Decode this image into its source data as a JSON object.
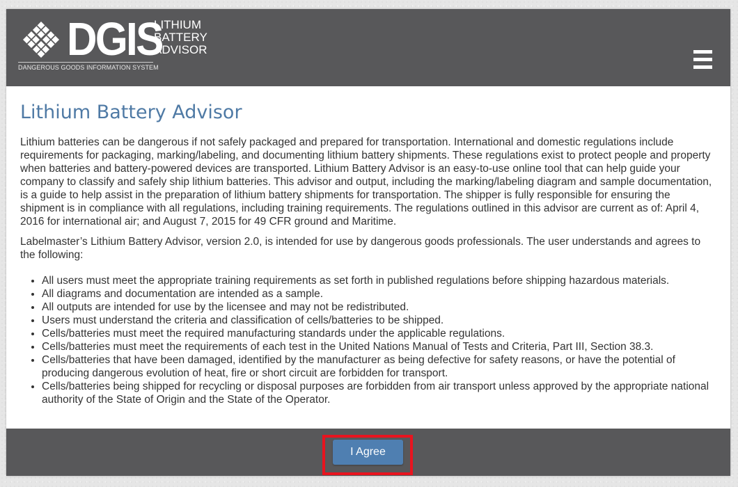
{
  "header": {
    "logo_text": "DGIS",
    "logo_sub_lines": [
      "LITHIUM",
      "BATTERY",
      "ADVISOR"
    ],
    "logo_tagline": "DANGEROUS GOODS INFORMATION SYSTEM",
    "menu_icon": "hamburger-menu-icon"
  },
  "main": {
    "title": "Lithium Battery Advisor",
    "paragraphs": [
      "Lithium batteries can be dangerous if not safely packaged and prepared for transportation. International and domestic regulations include requirements for packaging, marking/labeling, and documenting lithium battery shipments. These regulations exist to protect people and property when batteries and battery-powered devices are transported. Lithium Battery Advisor is an easy-to-use online tool that can help guide your company to classify and safely ship lithium batteries. This advisor and output, including the marking/labeling diagram and sample documentation, is a guide to help assist in the preparation of lithium battery shipments for transportation. The shipper is fully responsible for ensuring the shipment is in compliance with all regulations, including training requirements. The regulations outlined in this advisor are current as of: April 4, 2016 for international air; and August 7, 2015 for 49 CFR ground and Maritime.",
      "Labelmaster’s Lithium Battery Advisor, version 2.0, is intended for use by dangerous goods professionals. The user understands and agrees to the following:"
    ],
    "terms": [
      "All users must meet the appropriate training requirements as set forth in published regulations before shipping hazardous materials.",
      "All diagrams and documentation are intended as a sample.",
      "All outputs are intended for use by the licensee and may not be redistributed.",
      "Users must understand the criteria and classification of cells/batteries to be shipped.",
      "Cells/batteries must meet the required manufacturing standards under the applicable regulations.",
      "Cells/batteries must meet the requirements of each test in the United Nations Manual of Tests and Criteria, Part III, Section 38.3.",
      "Cells/batteries that have been damaged, identified by the manufacturer as being defective for safety reasons, or have the potential of producing dangerous evolution of heat, fire or short circuit are forbidden for transport.",
      "Cells/batteries being shipped for recycling or disposal purposes are forbidden from air transport unless approved by the appropriate national authority of the State of Origin and the State of the Operator."
    ]
  },
  "footer": {
    "agree_label": "I Agree"
  },
  "colors": {
    "header_bg": "#58585a",
    "title": "#4f7aa5",
    "button": "#4f7fb1",
    "highlight": "#e8141f"
  }
}
